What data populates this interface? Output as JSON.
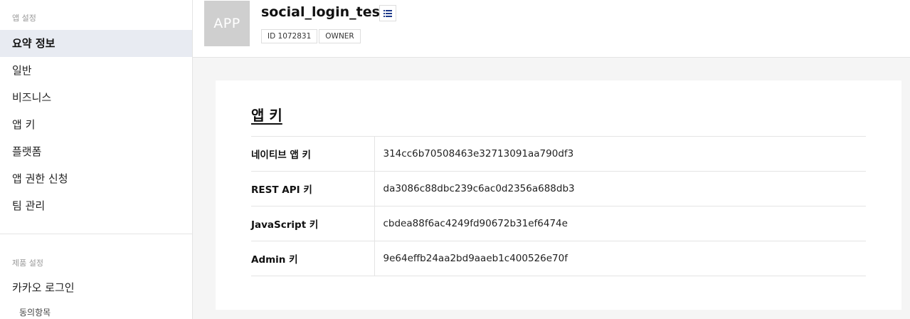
{
  "sidebar": {
    "section_app": "앱 설정",
    "items": [
      {
        "label": "요약 정보"
      },
      {
        "label": "일반"
      },
      {
        "label": "비즈니스"
      },
      {
        "label": "앱 키"
      },
      {
        "label": "플랫폼"
      },
      {
        "label": "앱 권한 신청"
      },
      {
        "label": "팀 관리"
      }
    ],
    "section_product": "제품 설정",
    "product_item": "카카오 로그인",
    "sub_item": "동의항목"
  },
  "header": {
    "app_icon_text": "APP",
    "app_name": "social_login_test",
    "badges": [
      "ID 1072831",
      "OWNER"
    ]
  },
  "card": {
    "title": "앱 키",
    "rows": [
      {
        "label": "네이티브 앱 키",
        "value": "314cc6b70508463e32713091aa790df3"
      },
      {
        "label": "REST API 키",
        "value": "da3086c88dbc239c6ac0d2356a688db3"
      },
      {
        "label": "JavaScript 키",
        "value": "cbdea88f6ac4249fd90672b31ef6474e"
      },
      {
        "label": "Admin 키",
        "value": "9e64effb24aa2bd9aaeb1c400526e70f"
      }
    ]
  },
  "colors": {
    "active_bg": "#e8ebf2",
    "icon_bg": "#cfcfcf",
    "list_icon": "#1e3a8a"
  },
  "icons": {
    "list_button": "list-icon"
  }
}
